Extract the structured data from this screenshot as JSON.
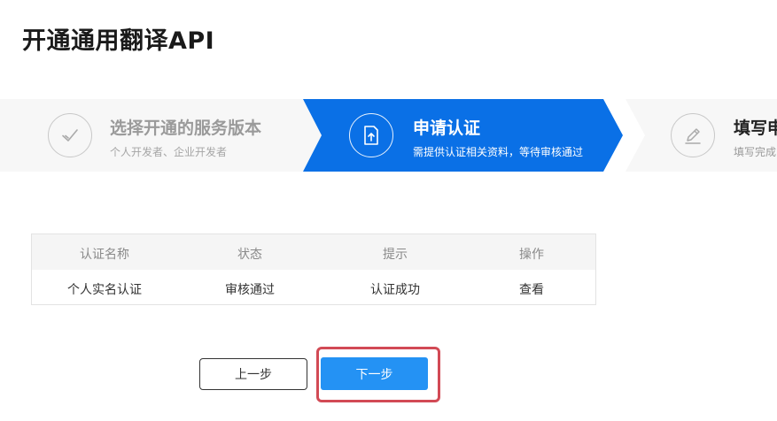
{
  "page": {
    "title": "开通通用翻译API"
  },
  "steps": [
    {
      "title": "选择开通的服务版本",
      "subtitle": "个人开发者、企业开发者",
      "icon": "check-icon",
      "state": "done"
    },
    {
      "title": "申请认证",
      "subtitle": "需提供认证相关资料，等待审核通过",
      "icon": "document-upload-icon",
      "state": "active"
    },
    {
      "title": "填写申",
      "subtitle": "填写完成",
      "icon": "pen-edit-icon",
      "state": "upcoming"
    }
  ],
  "table": {
    "headers": [
      "认证名称",
      "状态",
      "提示",
      "操作"
    ],
    "rows": [
      {
        "name": "个人实名认证",
        "status": "审核通过",
        "hint": "认证成功",
        "action": "查看"
      }
    ]
  },
  "buttons": {
    "prev_label": "上一步",
    "next_label": "下一步"
  },
  "colors": {
    "active_step": "#0a70e6",
    "next_button": "#2492f4",
    "link": "#1b73d8",
    "highlight": "#d24a55"
  }
}
